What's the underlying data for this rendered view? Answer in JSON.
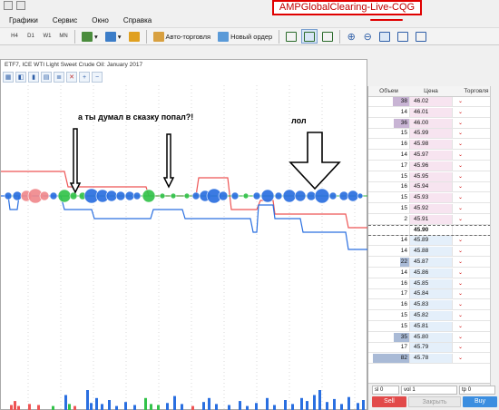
{
  "app": {
    "title": "AMPGlobalClearing-Live-CQG"
  },
  "menu": [
    "Графики",
    "Сервис",
    "Окно",
    "Справка"
  ],
  "toolbar": {
    "timeframes": [
      "H4",
      "D1",
      "W1",
      "MN"
    ],
    "auto_trading_label": "Авто-торговля",
    "new_order_label": "Новый ордер"
  },
  "chart": {
    "title": "ETF7, ICE WTI Light Sweet Crude Oil: January 2017",
    "annotations": {
      "left": "а ты думал в сказку попал?!",
      "right": "лол"
    }
  },
  "dom": {
    "headers": {
      "volume": "Объем",
      "price": "Цена",
      "trading": "Торговля"
    },
    "rows": [
      {
        "vol": "38",
        "price": "46.02",
        "side": "ask",
        "bar": 0.45
      },
      {
        "vol": "14",
        "price": "46.01",
        "side": "ask",
        "bar": 0
      },
      {
        "vol": "36",
        "price": "46.00",
        "side": "ask",
        "bar": 0.42
      },
      {
        "vol": "15",
        "price": "45.99",
        "side": "ask",
        "bar": 0
      },
      {
        "vol": "16",
        "price": "45.98",
        "side": "ask",
        "bar": 0
      },
      {
        "vol": "14",
        "price": "45.97",
        "side": "ask",
        "bar": 0
      },
      {
        "vol": "17",
        "price": "45.96",
        "side": "ask",
        "bar": 0
      },
      {
        "vol": "15",
        "price": "45.95",
        "side": "ask",
        "bar": 0
      },
      {
        "vol": "16",
        "price": "45.94",
        "side": "ask",
        "bar": 0
      },
      {
        "vol": "15",
        "price": "45.93",
        "side": "ask",
        "bar": 0
      },
      {
        "vol": "15",
        "price": "45.92",
        "side": "ask",
        "bar": 0
      },
      {
        "vol": "2",
        "price": "45.91",
        "side": "ask",
        "bar": 0
      },
      {
        "vol": "",
        "price": "45.90",
        "side": "cur",
        "bar": 0
      },
      {
        "vol": "14",
        "price": "45.89",
        "side": "bid",
        "bar": 0
      },
      {
        "vol": "14",
        "price": "45.88",
        "side": "bid",
        "bar": 0
      },
      {
        "vol": "22",
        "price": "45.87",
        "side": "bid",
        "bar": 0.26
      },
      {
        "vol": "14",
        "price": "45.86",
        "side": "bid",
        "bar": 0
      },
      {
        "vol": "16",
        "price": "45.85",
        "side": "bid",
        "bar": 0
      },
      {
        "vol": "17",
        "price": "45.84",
        "side": "bid",
        "bar": 0
      },
      {
        "vol": "16",
        "price": "45.83",
        "side": "bid",
        "bar": 0
      },
      {
        "vol": "15",
        "price": "45.82",
        "side": "bid",
        "bar": 0
      },
      {
        "vol": "15",
        "price": "45.81",
        "side": "bid",
        "bar": 0
      },
      {
        "vol": "35",
        "price": "45.80",
        "side": "bid",
        "bar": 0.42
      },
      {
        "vol": "17",
        "price": "45.79",
        "side": "bid",
        "bar": 0
      },
      {
        "vol": "82",
        "price": "45.78",
        "side": "bid",
        "bar": 1.0
      }
    ],
    "footer": {
      "sl_label": "sl",
      "sl_value": "0",
      "vol_label": "vol",
      "vol_value": "1",
      "tp_label": "tp",
      "tp_value": "0",
      "sell_label": "Sell",
      "close_label": "Закрыть",
      "buy_label": "Buy"
    }
  },
  "colors": {
    "ask_volume_bar": "#c8b4d4",
    "bid_volume_bar": "#a9bad6",
    "red_line": "#ee5555",
    "blue_line": "#2a6fe0",
    "green_bubble": "#33c24a",
    "blue_bubble": "#2a6fe0",
    "red_bubble": "#f0898c"
  }
}
